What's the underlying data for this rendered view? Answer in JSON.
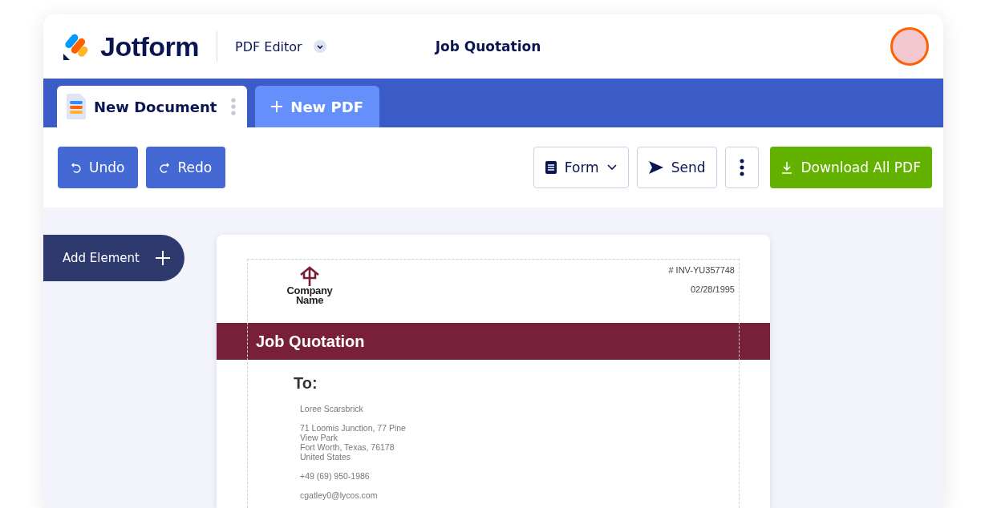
{
  "header": {
    "brand": "Jotform",
    "product": "PDF Editor",
    "title": "Job Quotation"
  },
  "tabs": [
    {
      "label": "New Document",
      "selected": true,
      "kind": "document"
    },
    {
      "label": "New PDF",
      "selected": false,
      "kind": "new"
    }
  ],
  "toolbar": {
    "left": [
      {
        "label": "Undo",
        "kind": "undo"
      },
      {
        "label": "Redo",
        "kind": "redo"
      }
    ],
    "right": [
      {
        "label": "Form",
        "kind": "form"
      },
      {
        "label": "Send",
        "kind": "send"
      },
      {
        "kind": "more"
      },
      {
        "label": "Download All PDF",
        "kind": "download"
      }
    ]
  },
  "add_element": {
    "label": "Add Element"
  },
  "document": {
    "company": [
      "Company",
      "Name"
    ],
    "invoice_number": "# INV-YU357748",
    "date": "02/28/1995",
    "heading": "Job Quotation",
    "to_label": "To:",
    "recipient": "Loree Scarsbrick",
    "address": [
      "71 Loomis Junction, 77 Pine",
      "View Park",
      "Fort Worth, Texas, 76178",
      "United States"
    ],
    "phone": "+49 (69) 950-1986",
    "email": "cgatley0@lycos.com"
  }
}
